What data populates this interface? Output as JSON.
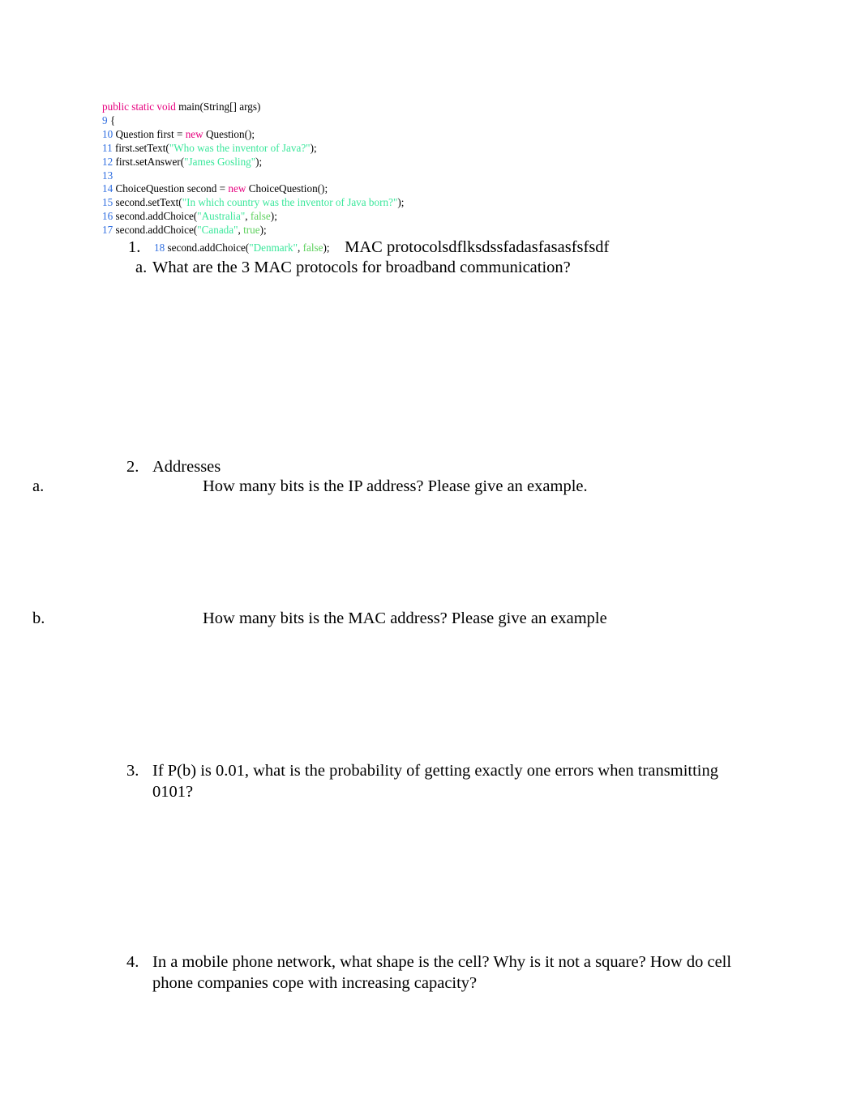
{
  "document": {
    "background_color": "#ffffff",
    "text_color": "#000000"
  },
  "code_block": {
    "syntax_colors": {
      "line_number": "#2f6ee0",
      "keyword": "#e6007e",
      "string": "#3ae79b",
      "boolean": "#5ed15e",
      "plain": "#000000"
    },
    "lines": [
      {
        "number": "",
        "segments": [
          {
            "type": "keyword",
            "text": "public static void"
          },
          {
            "type": "plain",
            "text": " main(String[] args)"
          }
        ]
      },
      {
        "number": "9",
        "segments": [
          {
            "type": "plain",
            "text": " {"
          }
        ]
      },
      {
        "number": "10",
        "segments": [
          {
            "type": "plain",
            "text": " Question first = "
          },
          {
            "type": "keyword",
            "text": "new"
          },
          {
            "type": "plain",
            "text": " Question();"
          }
        ]
      },
      {
        "number": "11",
        "segments": [
          {
            "type": "plain",
            "text": " first.setText("
          },
          {
            "type": "string",
            "text": "\"Who was the inventor of Java?\""
          },
          {
            "type": "plain",
            "text": ");"
          }
        ]
      },
      {
        "number": "12",
        "segments": [
          {
            "type": "plain",
            "text": " first.setAnswer("
          },
          {
            "type": "string",
            "text": "\"James Gosling\""
          },
          {
            "type": "plain",
            "text": ");"
          }
        ]
      },
      {
        "number": "13",
        "segments": [
          {
            "type": "plain",
            "text": ""
          }
        ]
      },
      {
        "number": "14",
        "segments": [
          {
            "type": "plain",
            "text": " ChoiceQuestion second = "
          },
          {
            "type": "keyword",
            "text": "new"
          },
          {
            "type": "plain",
            "text": " ChoiceQuestion();"
          }
        ]
      },
      {
        "number": "15",
        "segments": [
          {
            "type": "plain",
            "text": " second.setText("
          },
          {
            "type": "string",
            "text": "\"In which country was the inventor of Java born?\""
          },
          {
            "type": "plain",
            "text": ");"
          }
        ]
      },
      {
        "number": "16",
        "segments": [
          {
            "type": "plain",
            "text": " second.addChoice("
          },
          {
            "type": "string",
            "text": "\"Australia\""
          },
          {
            "type": "plain",
            "text": ", "
          },
          {
            "type": "boolean",
            "text": "false"
          },
          {
            "type": "plain",
            "text": ");"
          }
        ]
      },
      {
        "number": "17",
        "segments": [
          {
            "type": "plain",
            "text": " second.addChoice("
          },
          {
            "type": "string",
            "text": "\"Canada\""
          },
          {
            "type": "plain",
            "text": ", "
          },
          {
            "type": "boolean",
            "text": "true"
          },
          {
            "type": "plain",
            "text": ");"
          }
        ]
      }
    ],
    "inline_last_line": {
      "number": "18",
      "segments": [
        {
          "type": "plain",
          "text": " second.addChoice("
        },
        {
          "type": "string",
          "text": "\"Denmark\""
        },
        {
          "type": "plain",
          "text": ", "
        },
        {
          "type": "boolean",
          "text": "false"
        },
        {
          "type": "plain",
          "text": ");"
        }
      ]
    }
  },
  "list": {
    "item1": {
      "marker": "1.",
      "trailing_text": " MAC protocolsdflksdssfadasfasasfsfsdf",
      "sub_a": {
        "marker": "a.",
        "text": "What are the 3 MAC protocols for broadband communication?"
      }
    },
    "item2": {
      "marker": "2.",
      "text": "Addresses",
      "sub_a": {
        "marker": "a.",
        "text": "How many bits is the IP address? Please give an example."
      },
      "sub_b": {
        "marker": "b.",
        "text": "How many bits is the MAC address? Please give an example"
      }
    },
    "item3": {
      "marker": "3.",
      "text": "If P(b) is 0.01, what is the probability of getting exactly one errors when transmitting 0101?"
    },
    "item4": {
      "marker": "4.",
      "text": "In a mobile phone network, what shape is the cell? Why is it not a square? How do cell phone companies cope with increasing capacity?"
    }
  }
}
